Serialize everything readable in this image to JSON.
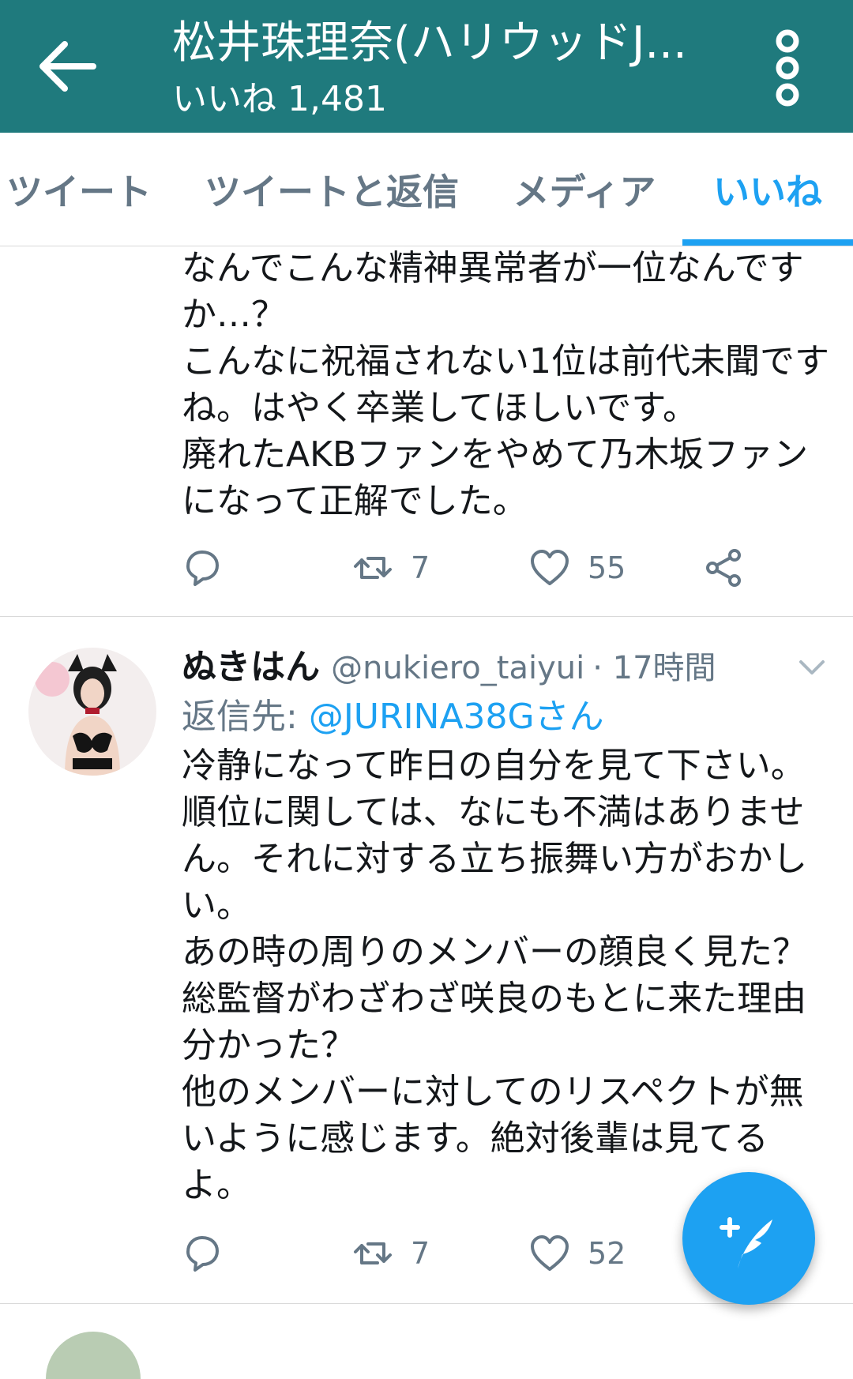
{
  "header": {
    "title": "松井珠理奈(ハリウッドJ...",
    "subtitle": "いいね 1,481",
    "bar_color": "#1f7a7d"
  },
  "tabs": [
    {
      "label": "ツイート",
      "active": false
    },
    {
      "label": "ツイートと返信",
      "active": false
    },
    {
      "label": "メディア",
      "active": false
    },
    {
      "label": "いいね",
      "active": true
    }
  ],
  "tweets": [
    {
      "text": "なんでこんな精神異常者が一位なんですか…？\nこんなに祝福されない1位は前代未聞ですね。はやく卒業してほしいです。\n廃れたAKBファンをやめて乃木坂ファンになって正解でした。",
      "retweets": "7",
      "likes": "55"
    },
    {
      "name": "ぬきはん",
      "handle": "@nukiero_taiyui",
      "time": "· 17時間",
      "reply_prefix": "返信先: ",
      "reply_handle": "@JURINA38Gさん",
      "text": "冷静になって昨日の自分を見て下さい。\n順位に関しては、なにも不満はありません。それに対する立ち振舞い方がおかしい。\nあの時の周りのメンバーの顔良く見た？\n総監督がわざわざ咲良のもとに来た理由分かった？\n他のメンバーに対してのリスペクトが無いように感じます。絶対後輩は見てるよ。",
      "retweets": "7",
      "likes": "52"
    }
  ],
  "colors": {
    "accent": "#1da1f2",
    "secondary_text": "#657786"
  },
  "icons": [
    "back-arrow-icon",
    "more-vertical-icon",
    "reply-icon",
    "retweet-icon",
    "heart-icon",
    "share-icon",
    "chevron-down-icon",
    "compose-tweet-icon"
  ]
}
